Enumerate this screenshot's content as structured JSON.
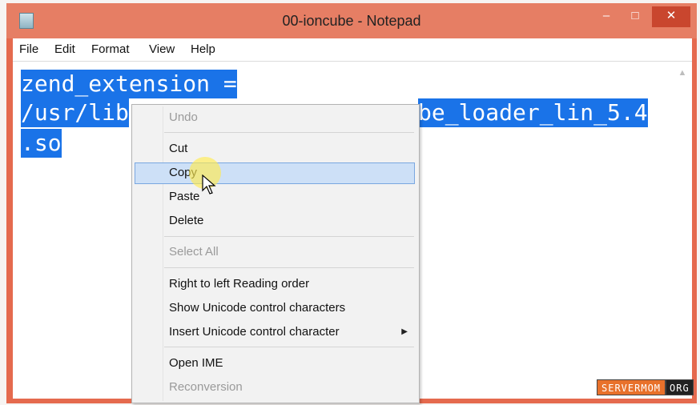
{
  "window": {
    "title": "00-ioncube - Notepad",
    "controls": {
      "minimize": "–",
      "maximize": "□",
      "close": "✕"
    }
  },
  "menubar": {
    "items": [
      "File",
      "Edit",
      "Format",
      "View",
      "Help"
    ]
  },
  "editor": {
    "lines": [
      "zend_extension =",
      "/usr/lib",
      "be_loader_lin_5.4",
      ".so"
    ],
    "scroll_icon": "chevron-up-icon"
  },
  "context_menu": {
    "undo": "Undo",
    "cut": "Cut",
    "copy": "Copy",
    "paste": "Paste",
    "delete": "Delete",
    "select_all": "Select All",
    "rtl": "Right to left Reading order",
    "show_unicode": "Show Unicode control characters",
    "insert_unicode": "Insert Unicode control character",
    "open_ime": "Open IME",
    "reconversion": "Reconversion",
    "highlighted": "Copy"
  },
  "watermark": {
    "part1": "SERVERMOM",
    "part2": "ORG"
  },
  "colors": {
    "titlebar": "#e67e64",
    "selection": "#1a73e8",
    "close_button": "#c9462e",
    "menu_highlight": "#cde0f7"
  }
}
